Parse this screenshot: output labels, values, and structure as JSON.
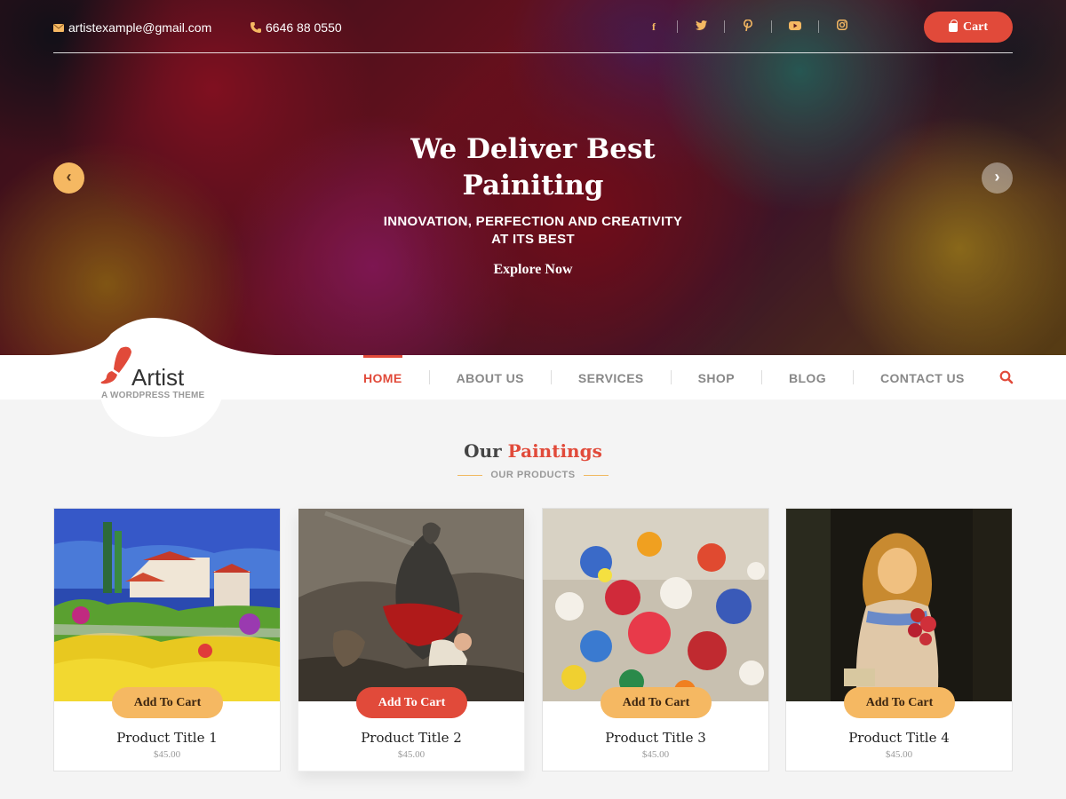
{
  "topbar": {
    "email": "artistexample@gmail.com",
    "phone": "6646 88 0550",
    "socials": [
      {
        "icon": "facebook-icon",
        "glyph": "f"
      },
      {
        "icon": "twitter-icon",
        "glyph": ""
      },
      {
        "icon": "pinterest-icon",
        "glyph": "P"
      },
      {
        "icon": "youtube-icon",
        "glyph": ""
      },
      {
        "icon": "instagram-icon",
        "glyph": ""
      }
    ],
    "cart_label": "Cart"
  },
  "slider": {
    "title_line1": "We Deliver Best",
    "title_line2": "Painiting",
    "subtitle_line1": "INNOVATION, PERFECTION AND CREATIVITY",
    "subtitle_line2": "AT ITS BEST",
    "link": "Explore Now",
    "prev": "‹",
    "next": "›"
  },
  "brand": {
    "name": "Artist",
    "tagline": "A WORDPRESS THEME"
  },
  "menu": {
    "items": [
      "HOME",
      "ABOUT US",
      "SERVICES",
      "SHOP",
      "BLOG",
      "CONTACT US"
    ],
    "active": "HOME"
  },
  "section": {
    "title_plain": "Our",
    "title_accent": "Paintings",
    "subtitle": "OUR PRODUCTS"
  },
  "products": [
    {
      "title": "Product Title 1",
      "price": "$45.00",
      "button": "Add To Cart"
    },
    {
      "title": "Product Title 2",
      "price": "$45.00",
      "button": "Add To Cart"
    },
    {
      "title": "Product Title 3",
      "price": "$45.00",
      "button": "Add To Cart"
    },
    {
      "title": "Product Title 4",
      "price": "$45.00",
      "button": "Add To Cart"
    }
  ],
  "colors": {
    "accent_red": "#e14a3a",
    "accent_gold": "#f5b862",
    "text_dark": "#333333",
    "text_muted": "#888888"
  }
}
